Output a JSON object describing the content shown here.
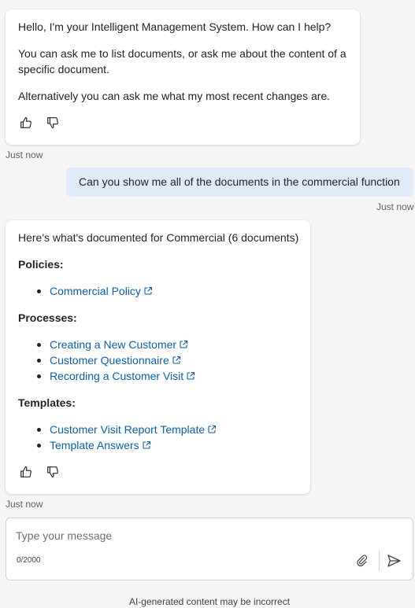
{
  "bot_message_1": {
    "lines": [
      "Hello, I'm your Intelligent Management System. How can I help?",
      "You can ask me to list documents, or ask me about the content of a specific document.",
      "Alternatively you can ask me what my most recent changes are."
    ],
    "timestamp": "Just now"
  },
  "user_message": {
    "text": "Can you show me all of the documents in the commercial function",
    "timestamp": "Just now"
  },
  "bot_message_2": {
    "intro": "Here's what's documented for Commercial (6 documents)",
    "sections": [
      {
        "heading": "Policies:",
        "links": [
          "Commercial Policy"
        ]
      },
      {
        "heading": "Processes:",
        "links": [
          "Creating a New Customer",
          "Customer Questionnaire",
          "Recording a Customer Visit"
        ]
      },
      {
        "heading": "Templates:",
        "links": [
          "Customer Visit Report Template",
          "Template Answers"
        ]
      }
    ],
    "timestamp": "Just now"
  },
  "feedback": {
    "like_icon": "thumbs-up-icon",
    "dislike_icon": "thumbs-down-icon"
  },
  "composer": {
    "placeholder": "Type your message",
    "value": "",
    "char_count": "0/2000",
    "attach_icon": "paperclip-icon",
    "send_icon": "send-icon"
  },
  "disclaimer": "AI-generated content may be incorrect",
  "colors": {
    "background": "#f5f5f5",
    "card": "#ffffff",
    "user_bubble": "#e0ebfa",
    "link": "#115ea3",
    "text": "#242424",
    "muted": "#616161"
  }
}
